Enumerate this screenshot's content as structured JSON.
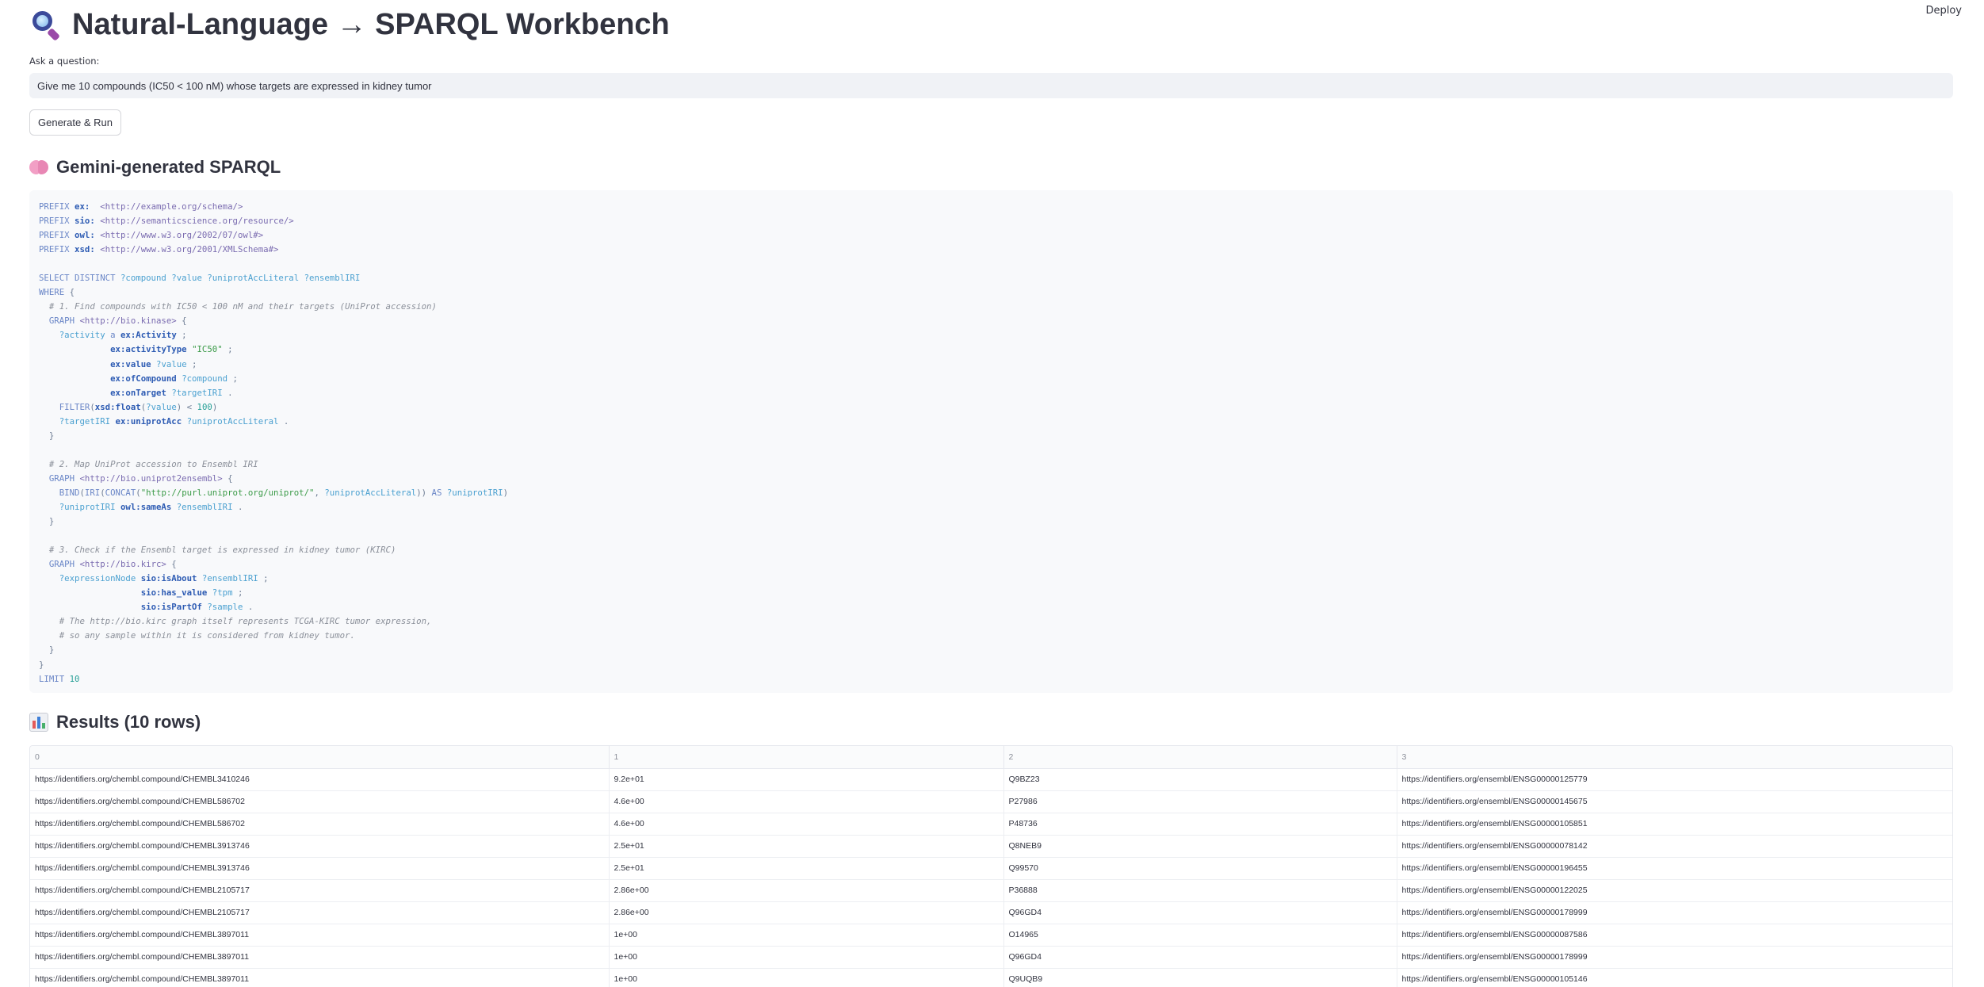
{
  "header": {
    "deploy_label": "Deploy"
  },
  "page": {
    "title": "Natural-Language → SPARQL Workbench"
  },
  "question": {
    "label": "Ask a question:",
    "value": "Give me 10 compounds (IC50 < 100 nM) whose targets are expressed in kidney tumor"
  },
  "generate_button": {
    "label": "Generate & Run"
  },
  "sparql_section": {
    "title": "Gemini-generated SPARQL"
  },
  "results_section": {
    "title": "Results (10 rows)",
    "columns": [
      "0",
      "1",
      "2",
      "3"
    ],
    "rows": [
      [
        "https://identifiers.org/chembl.compound/CHEMBL3410246",
        "9.2e+01",
        "Q9BZ23",
        "https://identifiers.org/ensembl/ENSG00000125779"
      ],
      [
        "https://identifiers.org/chembl.compound/CHEMBL586702",
        "4.6e+00",
        "P27986",
        "https://identifiers.org/ensembl/ENSG00000145675"
      ],
      [
        "https://identifiers.org/chembl.compound/CHEMBL586702",
        "4.6e+00",
        "P48736",
        "https://identifiers.org/ensembl/ENSG00000105851"
      ],
      [
        "https://identifiers.org/chembl.compound/CHEMBL3913746",
        "2.5e+01",
        "Q8NEB9",
        "https://identifiers.org/ensembl/ENSG00000078142"
      ],
      [
        "https://identifiers.org/chembl.compound/CHEMBL3913746",
        "2.5e+01",
        "Q99570",
        "https://identifiers.org/ensembl/ENSG00000196455"
      ],
      [
        "https://identifiers.org/chembl.compound/CHEMBL2105717",
        "2.86e+00",
        "P36888",
        "https://identifiers.org/ensembl/ENSG00000122025"
      ],
      [
        "https://identifiers.org/chembl.compound/CHEMBL2105717",
        "2.86e+00",
        "Q96GD4",
        "https://identifiers.org/ensembl/ENSG00000178999"
      ],
      [
        "https://identifiers.org/chembl.compound/CHEMBL3897011",
        "1e+00",
        "O14965",
        "https://identifiers.org/ensembl/ENSG00000087586"
      ],
      [
        "https://identifiers.org/chembl.compound/CHEMBL3897011",
        "1e+00",
        "Q96GD4",
        "https://identifiers.org/ensembl/ENSG00000178999"
      ],
      [
        "https://identifiers.org/chembl.compound/CHEMBL3897011",
        "1e+00",
        "Q9UQB9",
        "https://identifiers.org/ensembl/ENSG00000105146"
      ]
    ]
  },
  "sparql_lines": [
    [
      [
        "kw",
        "PREFIX "
      ],
      [
        "pfx",
        "ex:"
      ],
      [
        "t",
        "  "
      ],
      [
        "iri",
        "<http://example.org/schema/>"
      ]
    ],
    [
      [
        "kw",
        "PREFIX "
      ],
      [
        "pfx",
        "sio:"
      ],
      [
        "t",
        " "
      ],
      [
        "iri",
        "<http://semanticscience.org/resource/>"
      ]
    ],
    [
      [
        "kw",
        "PREFIX "
      ],
      [
        "pfx",
        "owl:"
      ],
      [
        "t",
        " "
      ],
      [
        "iri",
        "<http://www.w3.org/2002/07/owl#>"
      ]
    ],
    [
      [
        "kw",
        "PREFIX "
      ],
      [
        "pfx",
        "xsd:"
      ],
      [
        "t",
        " "
      ],
      [
        "iri",
        "<http://www.w3.org/2001/XMLSchema#>"
      ]
    ],
    [
      [
        "t",
        ""
      ]
    ],
    [
      [
        "kw",
        "SELECT DISTINCT "
      ],
      [
        "var",
        "?compound ?value ?uniprotAccLiteral ?ensemblIRI"
      ]
    ],
    [
      [
        "kw",
        "WHERE"
      ],
      [
        "t",
        " {"
      ]
    ],
    [
      [
        "cm",
        "  # 1. Find compounds with IC50 < 100 nM and their targets (UniProt accession)"
      ]
    ],
    [
      [
        "kw",
        "  GRAPH "
      ],
      [
        "iri",
        "<http://bio.kinase>"
      ],
      [
        "t",
        " {"
      ]
    ],
    [
      [
        "var",
        "    ?activity "
      ],
      [
        "kw",
        "a "
      ],
      [
        "pfx",
        "ex:Activity"
      ],
      [
        "t",
        " ;"
      ]
    ],
    [
      [
        "t",
        "              "
      ],
      [
        "pfx",
        "ex:activityType"
      ],
      [
        "t",
        " "
      ],
      [
        "str",
        "\"IC50\""
      ],
      [
        "t",
        " ;"
      ]
    ],
    [
      [
        "t",
        "              "
      ],
      [
        "pfx",
        "ex:value"
      ],
      [
        "t",
        " "
      ],
      [
        "var",
        "?value"
      ],
      [
        "t",
        " ;"
      ]
    ],
    [
      [
        "t",
        "              "
      ],
      [
        "pfx",
        "ex:ofCompound"
      ],
      [
        "t",
        " "
      ],
      [
        "var",
        "?compound"
      ],
      [
        "t",
        " ;"
      ]
    ],
    [
      [
        "t",
        "              "
      ],
      [
        "pfx",
        "ex:onTarget"
      ],
      [
        "t",
        " "
      ],
      [
        "var",
        "?targetIRI"
      ],
      [
        "t",
        " ."
      ]
    ],
    [
      [
        "kw",
        "    FILTER"
      ],
      [
        "t",
        "("
      ],
      [
        "pfx",
        "xsd:float"
      ],
      [
        "t",
        "("
      ],
      [
        "var",
        "?value"
      ],
      [
        "t",
        ") < "
      ],
      [
        "num",
        "100"
      ],
      [
        "t",
        ")"
      ]
    ],
    [
      [
        "var",
        "    ?targetIRI "
      ],
      [
        "pfx",
        "ex:uniprotAcc"
      ],
      [
        "t",
        " "
      ],
      [
        "var",
        "?uniprotAccLiteral"
      ],
      [
        "t",
        " ."
      ]
    ],
    [
      [
        "t",
        "  }"
      ]
    ],
    [
      [
        "t",
        ""
      ]
    ],
    [
      [
        "cm",
        "  # 2. Map UniProt accession to Ensembl IRI"
      ]
    ],
    [
      [
        "kw",
        "  GRAPH "
      ],
      [
        "iri",
        "<http://bio.uniprot2ensembl>"
      ],
      [
        "t",
        " {"
      ]
    ],
    [
      [
        "kw",
        "    BIND"
      ],
      [
        "t",
        "("
      ],
      [
        "kw",
        "IRI"
      ],
      [
        "t",
        "("
      ],
      [
        "kw",
        "CONCAT"
      ],
      [
        "t",
        "("
      ],
      [
        "str",
        "\"http://purl.uniprot.org/uniprot/\""
      ],
      [
        "t",
        ", "
      ],
      [
        "var",
        "?uniprotAccLiteral"
      ],
      [
        "t",
        ")) "
      ],
      [
        "kw",
        "AS "
      ],
      [
        "var",
        "?uniprotIRI"
      ],
      [
        "t",
        ")"
      ]
    ],
    [
      [
        "var",
        "    ?uniprotIRI "
      ],
      [
        "pfx",
        "owl:sameAs"
      ],
      [
        "t",
        " "
      ],
      [
        "var",
        "?ensemblIRI"
      ],
      [
        "t",
        " ."
      ]
    ],
    [
      [
        "t",
        "  }"
      ]
    ],
    [
      [
        "t",
        ""
      ]
    ],
    [
      [
        "cm",
        "  # 3. Check if the Ensembl target is expressed in kidney tumor (KIRC)"
      ]
    ],
    [
      [
        "kw",
        "  GRAPH "
      ],
      [
        "iri",
        "<http://bio.kirc>"
      ],
      [
        "t",
        " {"
      ]
    ],
    [
      [
        "var",
        "    ?expressionNode "
      ],
      [
        "pfx",
        "sio:isAbout"
      ],
      [
        "t",
        " "
      ],
      [
        "var",
        "?ensemblIRI"
      ],
      [
        "t",
        " ;"
      ]
    ],
    [
      [
        "t",
        "                    "
      ],
      [
        "pfx",
        "sio:has_value"
      ],
      [
        "t",
        " "
      ],
      [
        "var",
        "?tpm"
      ],
      [
        "t",
        " ;"
      ]
    ],
    [
      [
        "t",
        "                    "
      ],
      [
        "pfx",
        "sio:isPartOf"
      ],
      [
        "t",
        " "
      ],
      [
        "var",
        "?sample"
      ],
      [
        "t",
        " ."
      ]
    ],
    [
      [
        "cm",
        "    # The http://bio.kirc graph itself represents TCGA-KIRC tumor expression,"
      ]
    ],
    [
      [
        "cm",
        "    # so any sample within it is considered from kidney tumor."
      ]
    ],
    [
      [
        "t",
        "  }"
      ]
    ],
    [
      [
        "t",
        "}"
      ]
    ],
    [
      [
        "kw",
        "LIMIT "
      ],
      [
        "num",
        "10"
      ]
    ]
  ],
  "icons": {
    "title": "magnifying-glass-icon",
    "sparql": "brain-icon",
    "results": "bar-chart-icon"
  }
}
